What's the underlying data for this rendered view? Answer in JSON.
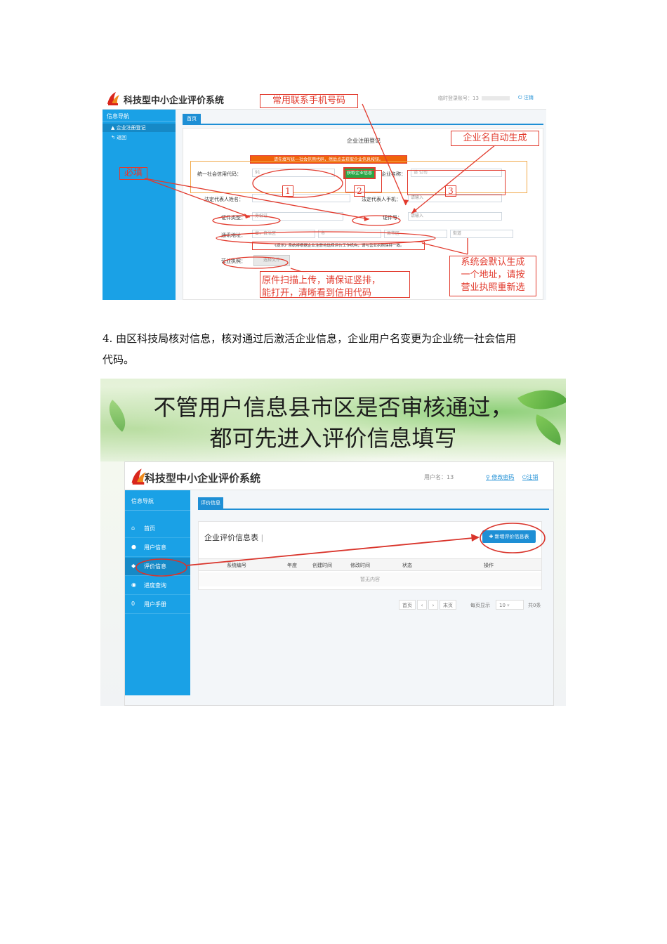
{
  "shot1": {
    "system_title": "科技型中小企业评价系统",
    "login_info": "临时登录账号：13",
    "logout_label": "注销",
    "sidebar_title": "信息导航",
    "sidebar_items": [
      "企业注册登记",
      "返回"
    ],
    "tab_label": "首页",
    "form_title": "企业注册登记",
    "tip_bar": "请先填写统一社会信用代码，然后点击获取企业信息按钮。",
    "labels": {
      "credit_code": "统一社会信用代码：",
      "credit_code_value": "91",
      "get_info_button": "获取企业信息",
      "company_name": "企业名称：",
      "company_name_value": "请     公司",
      "legal_name": "法定代表人姓名：",
      "legal_phone": "法定代表人手机：",
      "phone_placeholder": "请输入",
      "id_type": "证件类型：",
      "id_type_value": "身份证",
      "id_number": "证件号：",
      "id_placeholder": "请输入",
      "address": "通讯地址：",
      "address_values": [
        "省，自治区",
        "市",
        "县市区",
        "街道"
      ],
      "notice": "《提示》系统将根据企业注册地选择评价工作机构，请与营业执照保持一致。",
      "license": "营业执照：",
      "upload_button": "选择文件"
    },
    "annotations": {
      "phone_note": "常用联系手机号码",
      "name_note": "企业名自动生成",
      "required_note": "必填",
      "num1": "1",
      "num2": "2",
      "num3": "3",
      "upload_note_1": "原件扫描上传，请保证竖排，",
      "upload_note_2": "能打开，清晰看到信用代码",
      "address_note_1": "系统会默认生成",
      "address_note_2": "一个地址，请按",
      "address_note_3": "营业执照重新选"
    }
  },
  "paragraph": {
    "line1": "4.  由区科技局核对信息，核对通过后激活企业信息，企业用户名变更为企业统一社会信用",
    "line2": "代码。"
  },
  "shot2": {
    "banner_line1": "不管用户信息县市区是否审核通过，",
    "banner_line2": "都可先进入评价信息填写",
    "system_title": "科技型中小企业评价系统",
    "user_label": "用户名：13",
    "change_password": "修改密码",
    "logout_label": "注销",
    "sidebar_title": "信息导航",
    "nav": [
      {
        "icon": "home-icon",
        "glyph": "⌂",
        "label": "首页"
      },
      {
        "icon": "user-icon",
        "glyph": "●",
        "label": "用户信息"
      },
      {
        "icon": "tag-icon",
        "glyph": "◆",
        "label": "评价信息"
      },
      {
        "icon": "eye-icon",
        "glyph": "◉",
        "label": "进度查询"
      },
      {
        "icon": "zero-icon",
        "glyph": "0",
        "label": "用户手册"
      }
    ],
    "tab_label": "评价信息",
    "panel_title": "企业评价信息表",
    "add_button": "新增评价信息表",
    "columns": [
      "系统编号",
      "年度",
      "创建时间",
      "修改时间",
      "状态",
      "操作"
    ],
    "empty_text": "暂无内容",
    "pager": {
      "first": "首页",
      "prev": "‹",
      "next": "›",
      "last": "末页",
      "per_page_label": "每页显示",
      "per_page_value": "10",
      "per_page_unit": "共0条"
    }
  },
  "colors": {
    "sidebar_blue": "#1aa1e6",
    "annotation_red": "#e23a2d",
    "orange_tip": "#f0640a",
    "green_button": "#28a745"
  }
}
